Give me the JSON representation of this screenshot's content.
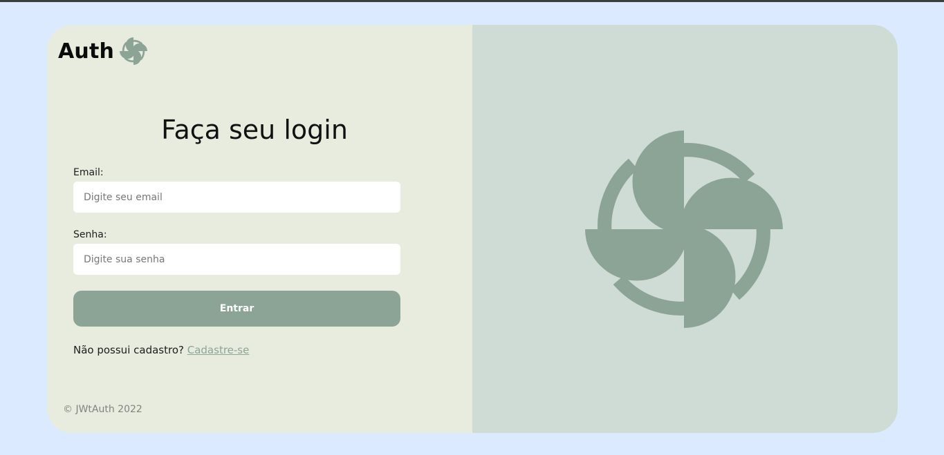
{
  "brand": {
    "name": "Auth",
    "icon": "pinwheel-logo-icon"
  },
  "login": {
    "title": "Faça seu login",
    "email_label": "Email:",
    "email_placeholder": "Digite seu email",
    "password_label": "Senha:",
    "password_placeholder": "Digite sua senha",
    "submit_label": "Entrar",
    "signup_prompt": "Não possui cadastro?",
    "signup_link": "Cadastre-se"
  },
  "footer": {
    "copyright": "© JWtAuth 2022"
  },
  "hero": {
    "icon": "pinwheel-illustration-icon"
  },
  "colors": {
    "page_background": "#dbeafe",
    "left_panel": "#e8ecdf",
    "right_panel": "#cfdcd5",
    "accent": "#8ba496",
    "input_background": "#ffffff"
  }
}
